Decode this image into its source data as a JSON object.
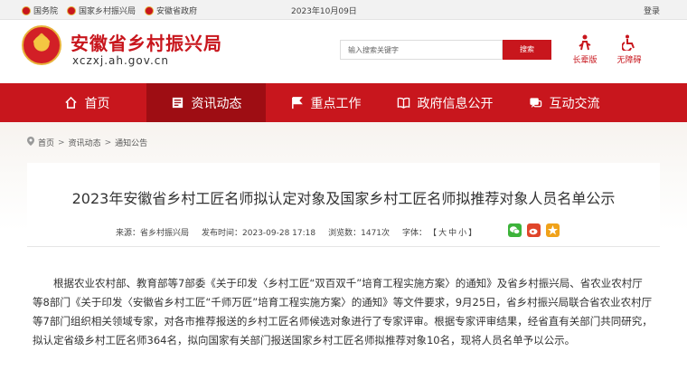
{
  "topbar": {
    "links": [
      "国务院",
      "国家乡村振兴局",
      "安徽省政府"
    ],
    "date": "2023年10月09日",
    "login": "登录"
  },
  "header": {
    "site_name": "安徽省乡村振兴局",
    "domain": "xczxj.ah.gov.cn",
    "search_placeholder": "输入搜索关键字",
    "search_button": "搜索",
    "tools": [
      {
        "label": "长辈版",
        "icon": "elder-icon"
      },
      {
        "label": "无障碍",
        "icon": "accessibility-icon"
      }
    ]
  },
  "nav": {
    "items": [
      {
        "label": "首页",
        "icon": "home-icon"
      },
      {
        "label": "资讯动态",
        "icon": "news-icon"
      },
      {
        "label": "重点工作",
        "icon": "flag-icon"
      },
      {
        "label": "政府信息公开",
        "icon": "book-icon"
      },
      {
        "label": "互动交流",
        "icon": "chat-icon"
      }
    ]
  },
  "breadcrumb": [
    "首页",
    "资讯动态",
    "通知公告"
  ],
  "breadcrumb_sep": ">",
  "article": {
    "title": "2023年安徽省乡村工匠名师拟认定对象及国家乡村工匠名师拟推荐对象人员名单公示",
    "source": "来源：省乡村振兴局",
    "published": "发布时间：2023-09-28 17:18",
    "views": "浏览数：1471次",
    "font_label": "字体：",
    "font_open": "【",
    "font_sizes": [
      "大",
      "中",
      "小"
    ],
    "font_close": "】",
    "share_icons": [
      "wechat-icon",
      "weibo-icon",
      "favorite-icon"
    ],
    "body": "根据农业农村部、教育部等7部委《关于印发〈乡村工匠“双百双千”培育工程实施方案〉的通知》及省乡村振兴局、省农业农村厅等8部门《关于印发〈安徽省乡村工匠“千师万匠”培育工程实施方案〉的通知》等文件要求，9月25日，省乡村振兴局联合省农业农村厅等7部门组织相关领域专家，对各市推荐报送的乡村工匠名师候选对象进行了专家评审。根据专家评审结果，经省直有关部门共同研究，拟认定省级乡村工匠名师364名，拟向国家有关部门报送国家乡村工匠名师拟推荐对象10名，现将人员名单予以公示。"
  },
  "colors": {
    "accent": "#c8161d",
    "nav_active": "#9e0d13"
  }
}
